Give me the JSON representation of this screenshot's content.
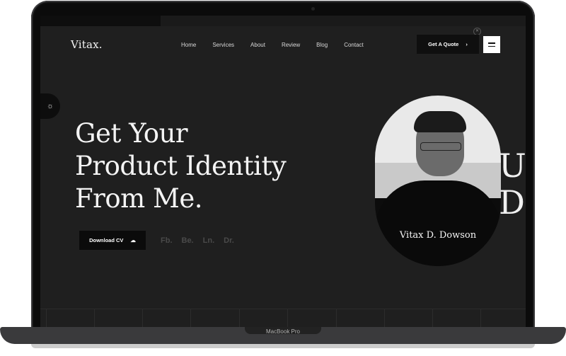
{
  "device": {
    "model_label": "MacBook Pro"
  },
  "site": {
    "brand": "Vitax.",
    "nav": [
      "Home",
      "Services",
      "About",
      "Review",
      "Blog",
      "Contact"
    ],
    "quote_button": "Get A Quote",
    "quote_arrow": "›",
    "close_symbol": "✕",
    "theme_toggle_symbol": "☼",
    "hero_lines": [
      "Get Your",
      "Product Identity",
      "From Me."
    ],
    "download_button": "Download CV",
    "download_icon": "☁",
    "socials": [
      "Fb.",
      "Be.",
      "Ln.",
      "Dr."
    ],
    "portrait_name": "Vitax D. Dowson",
    "bg_letters": [
      "U",
      "D"
    ]
  },
  "colors": {
    "page_bg": "#1f1f1f",
    "button_bg": "#0f0f0f",
    "text": "#f4f4f4"
  }
}
